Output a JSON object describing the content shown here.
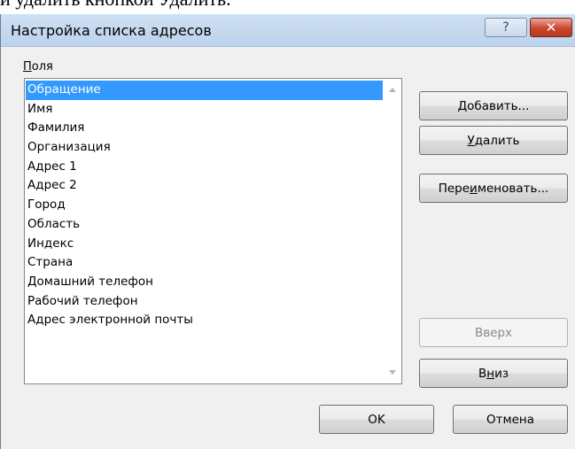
{
  "document": {
    "text_fragment": "и удалить кнопкой Удалить."
  },
  "dialog": {
    "title": "Настройка списка адресов",
    "help_label": "?",
    "close_label": "✕"
  },
  "fields": {
    "label_accel": "П",
    "label_rest": "оля",
    "items": [
      "Обращение",
      "Имя",
      "Фамилия",
      "Организация",
      "Адрес 1",
      "Адрес 2",
      "Город",
      "Область",
      "Индекс",
      "Страна",
      "Домашний телефон",
      "Рабочий телефон",
      "Адрес электронной почты"
    ],
    "selected_index": 0
  },
  "buttons": {
    "add": {
      "accel": "Д",
      "rest": "обавить..."
    },
    "delete": {
      "accel": "У",
      "rest": "далить"
    },
    "rename": {
      "pre": "Пере",
      "accel": "и",
      "rest": "меновать..."
    },
    "up": {
      "label": "Вверх"
    },
    "down": {
      "pre": "В",
      "accel": "н",
      "rest": "из"
    },
    "ok": {
      "label": "OK"
    },
    "cancel": {
      "label": "Отмена"
    }
  },
  "colors": {
    "selection": "#3399ff",
    "close_button": "#c9462c",
    "titlebar": "#c4d8ee"
  }
}
